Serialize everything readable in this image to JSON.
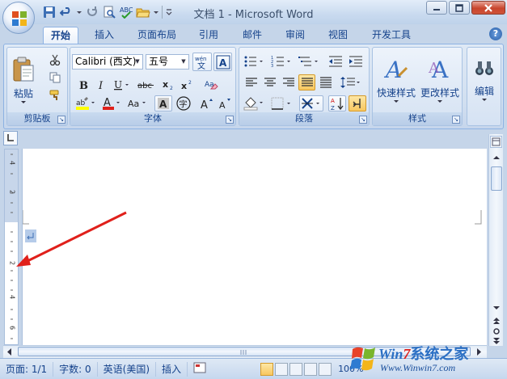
{
  "window": {
    "title": "文档 1 - Microsoft Word"
  },
  "tabs": [
    {
      "label": "开始",
      "active": true
    },
    {
      "label": "插入",
      "active": false
    },
    {
      "label": "页面布局",
      "active": false
    },
    {
      "label": "引用",
      "active": false
    },
    {
      "label": "邮件",
      "active": false
    },
    {
      "label": "审阅",
      "active": false
    },
    {
      "label": "视图",
      "active": false
    },
    {
      "label": "开发工具",
      "active": false
    }
  ],
  "ribbon": {
    "clipboard": {
      "label": "剪贴板",
      "paste": "粘贴"
    },
    "font": {
      "label": "字体",
      "font_name": "Calibri (西文)",
      "font_size": "五号"
    },
    "paragraph": {
      "label": "段落"
    },
    "styles": {
      "label": "样式",
      "quick_styles": "快速样式",
      "change_styles": "更改样式"
    },
    "editing": {
      "label": "编辑"
    }
  },
  "ruler": {
    "vertical_ticks": [
      "4",
      "2",
      "2",
      "4",
      "6"
    ]
  },
  "statusbar": {
    "page": "页面: 1/1",
    "words": "字数: 0",
    "language": "英语(美国)",
    "mode": "插入",
    "zoom": "100%"
  },
  "watermark": {
    "brand_a": "Win",
    "brand_b": "7",
    "brand_c": "系统之家",
    "url": "Www.Winwin7.com"
  },
  "colors": {
    "accent": "#15428b",
    "highlight": "#f8c75f",
    "arrow": "#e0201b"
  }
}
